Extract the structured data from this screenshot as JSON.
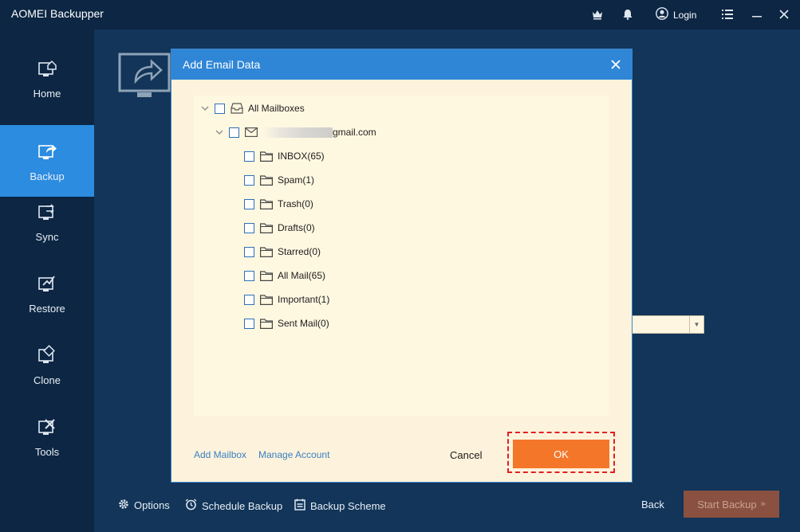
{
  "app": {
    "title": "AOMEI Backupper",
    "login_label": "Login"
  },
  "sidebar": {
    "items": [
      {
        "label": "Home",
        "icon": "home-icon"
      },
      {
        "label": "Backup",
        "icon": "backup-icon",
        "active": true
      },
      {
        "label": "Sync",
        "icon": "sync-icon"
      },
      {
        "label": "Restore",
        "icon": "restore-icon"
      },
      {
        "label": "Clone",
        "icon": "clone-icon"
      },
      {
        "label": "Tools",
        "icon": "tools-icon"
      }
    ]
  },
  "bottombar": {
    "options": "Options",
    "schedule": "Schedule Backup",
    "scheme": "Backup Scheme",
    "back": "Back",
    "start": "Start Backup"
  },
  "dialog": {
    "title": "Add Email Data",
    "root_label": "All Mailboxes",
    "account_label": "gmail.com",
    "folders": [
      {
        "label": "INBOX(65)"
      },
      {
        "label": "Spam(1)"
      },
      {
        "label": "Trash(0)"
      },
      {
        "label": "Drafts(0)"
      },
      {
        "label": "Starred(0)"
      },
      {
        "label": "All Mail(65)"
      },
      {
        "label": "Important(1)"
      },
      {
        "label": "Sent Mail(0)"
      }
    ],
    "add_mailbox": "Add Mailbox",
    "manage_account": "Manage Account",
    "cancel": "Cancel",
    "ok": "OK"
  },
  "colors": {
    "accent": "#2f86d6",
    "ok_button": "#f47629",
    "highlight_outline": "#e31e24",
    "dialog_bg": "#fdf3dc"
  }
}
